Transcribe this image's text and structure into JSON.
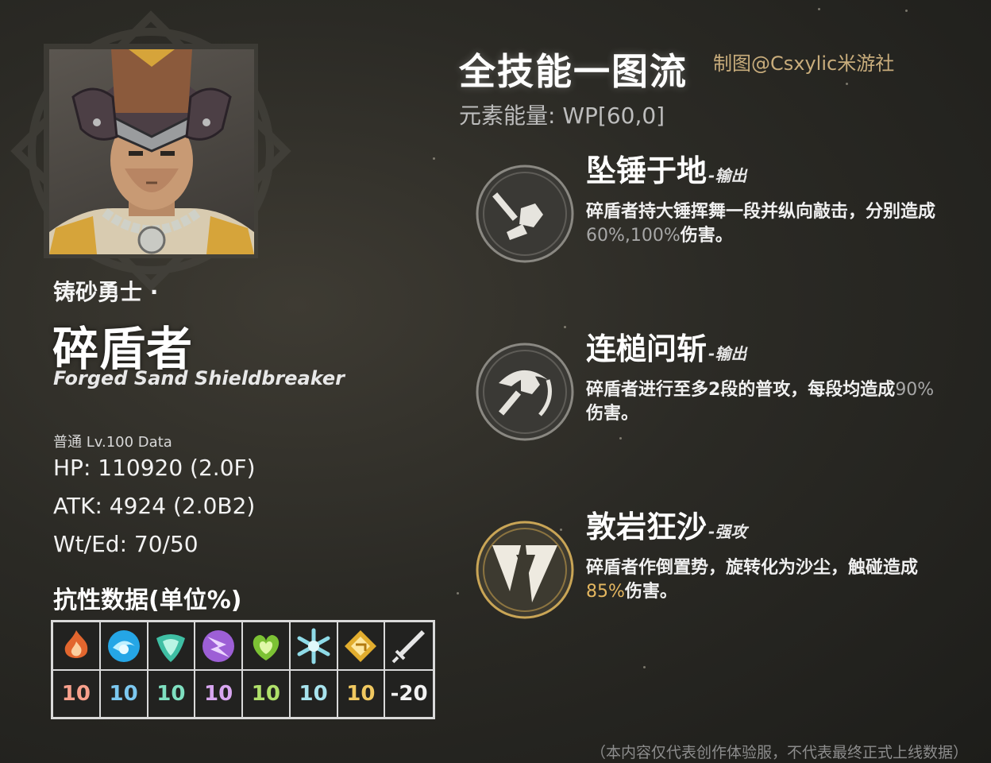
{
  "character": {
    "subtitle": "铸砂勇士 ·",
    "name": "碎盾者",
    "english_name": "Forged Sand Shieldbreaker"
  },
  "stats": {
    "data_level": "普通 Lv.100 Data",
    "hp": "HP: 110920 (2.0F)",
    "atk": "ATK: 4924 (2.0B2)",
    "weight": "Wt/Ed: 70/50"
  },
  "resistance": {
    "title": "抗性数据(单位%)",
    "items": [
      {
        "icon": "pyro-icon",
        "value": "10",
        "color": "#f7a08c"
      },
      {
        "icon": "hydro-icon",
        "value": "10",
        "color": "#7cc8f0"
      },
      {
        "icon": "anemo-icon",
        "value": "10",
        "color": "#7fe0c0"
      },
      {
        "icon": "electro-icon",
        "value": "10",
        "color": "#d8a6f0"
      },
      {
        "icon": "dendro-icon",
        "value": "10",
        "color": "#b0e06a"
      },
      {
        "icon": "cryo-icon",
        "value": "10",
        "color": "#a8e4ee"
      },
      {
        "icon": "geo-icon",
        "value": "10",
        "color": "#f0c860"
      },
      {
        "icon": "physical-sword-icon",
        "value": "-20",
        "color": "#f2f2f2"
      }
    ]
  },
  "header": {
    "title": "全技能一图流",
    "credit": "制图@Csxylic米游社",
    "energy": "元素能量: WP[60,0]"
  },
  "skills": [
    {
      "icon": "hammer-smash-icon",
      "name": "坠锤于地",
      "tag": "-输出",
      "desc_pre": "碎盾者持大锤挥舞一段并纵向敲击，分别造成",
      "desc_num": "60%,100%",
      "desc_post": "伤害。"
    },
    {
      "icon": "hammer-swing-icon",
      "name": "连槌问斩",
      "tag": "-输出",
      "desc_pre": "碎盾者进行至多2段的普攻，每段均造成",
      "desc_num": "90%",
      "desc_post": "伤害。"
    },
    {
      "icon": "sand-vortex-icon",
      "name": "敦岩狂沙",
      "tag": "-强攻",
      "desc_pre": "碎盾者作倒置势，旋转化为沙尘，触碰造成",
      "desc_num": "85%",
      "desc_post": "伤害。"
    }
  ],
  "footer": {
    "disclaimer": "（本内容仅代表创作体验服，不代表最终正式上线数据）"
  }
}
